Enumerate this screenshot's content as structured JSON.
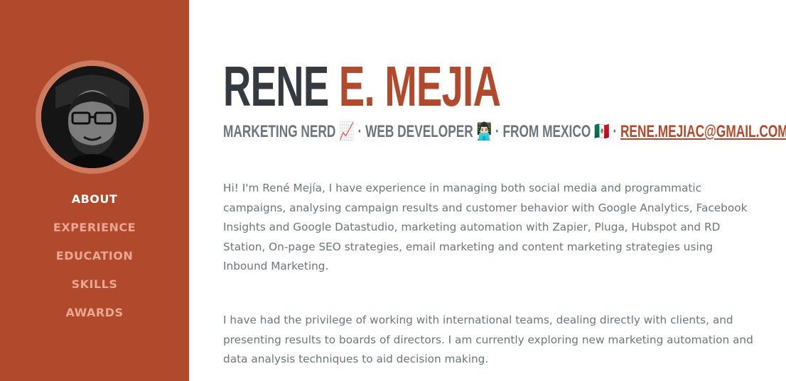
{
  "sidebar": {
    "avatar_alt": "Profile photo",
    "nav": [
      {
        "label": "ABOUT",
        "active": true
      },
      {
        "label": "EXPERIENCE",
        "active": false
      },
      {
        "label": "EDUCATION",
        "active": false
      },
      {
        "label": "SKILLS",
        "active": false
      },
      {
        "label": "AWARDS",
        "active": false
      }
    ]
  },
  "header": {
    "first_name": "RENE",
    "last_name": "E. MEJIA",
    "subheading": {
      "text": "MARKETING NERD 📈 · WEB DEVELOPER 👨🏻‍💻 · FROM MEXICO 🇲🇽 · ",
      "email": "RENE.MEJIAC@GMAIL.COM"
    }
  },
  "about": {
    "paragraphs": [
      "Hi! I'm René Mejía, I have experience in managing both social media and programmatic campaigns, analysing campaign results and customer behavior with Google Analytics, Facebook Insights and Google Datastudio, marketing automation with Zapier, Pluga, Hubspot and RD Station, On-page SEO strategies, email marketing and content marketing strategies using Inbound Marketing.",
      "I have had the privilege of working with international teams, dealing directly with clients, and presenting results to boards of directors. I am currently exploring new marketing automation and data analysis techniques to aid decision making."
    ]
  },
  "colors": {
    "primary": "#b14a2c",
    "text_dark": "#343a40",
    "text_muted": "#6c757d",
    "nav_inactive": "#e8a891"
  }
}
